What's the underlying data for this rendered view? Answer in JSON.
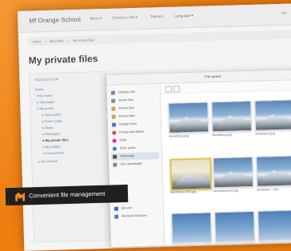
{
  "site": {
    "brand": "Mf Orange School",
    "menu": [
      "Menu ▾",
      "Choose a role ▾",
      "Taxform",
      "Language ▾"
    ],
    "right_text": "Mo"
  },
  "breadcrumb": [
    "Home",
    "My profile",
    "My private files"
  ],
  "page_title": "My private files",
  "navigation": {
    "heading": "NAVIGATION",
    "items": [
      "Home",
      "▾ My home",
      "▸ Site pages",
      "▾ My profile",
      "▸ View profile",
      "▸ Forum posts",
      "▸ Blogs",
      "▸ Messages",
      "▸ My private files",
      "▸ My badges",
      "▸ Assessments",
      "▸ My courses"
    ]
  },
  "file_picker": {
    "title": "File picker",
    "repositories": [
      "Upload a file",
      "Server files",
      "Private files",
      "Recent files",
      "Google Drive",
      "Picasa web album",
      "Flickr",
      "Flickr public",
      "Wikimedia",
      "URL downloader",
      "Box.net",
      "Microsoft SkyDrive"
    ],
    "files": [
      {
        "name": "MontBlanc.jpeg",
        "type": "mountain"
      },
      {
        "name": "MontBlanc.jpeg",
        "type": "mountain"
      },
      {
        "name": "MontBlanc.jpeg",
        "type": "mountain"
      },
      {
        "name": "MontBlanc-8291.jpg",
        "type": "painting"
      },
      {
        "name": "MontBlanc.from.jpg",
        "type": "mountain"
      },
      {
        "name": "MontBlanc - snip",
        "type": "mountain"
      },
      {
        "name": "",
        "type": "sky"
      },
      {
        "name": "",
        "type": "sky"
      },
      {
        "name": "",
        "type": "sky"
      }
    ]
  },
  "caption": "Convenient file management",
  "colors": {
    "accent": "#f07f12",
    "link": "#5a8ab8",
    "caption_bg": "#1f1f1f"
  }
}
